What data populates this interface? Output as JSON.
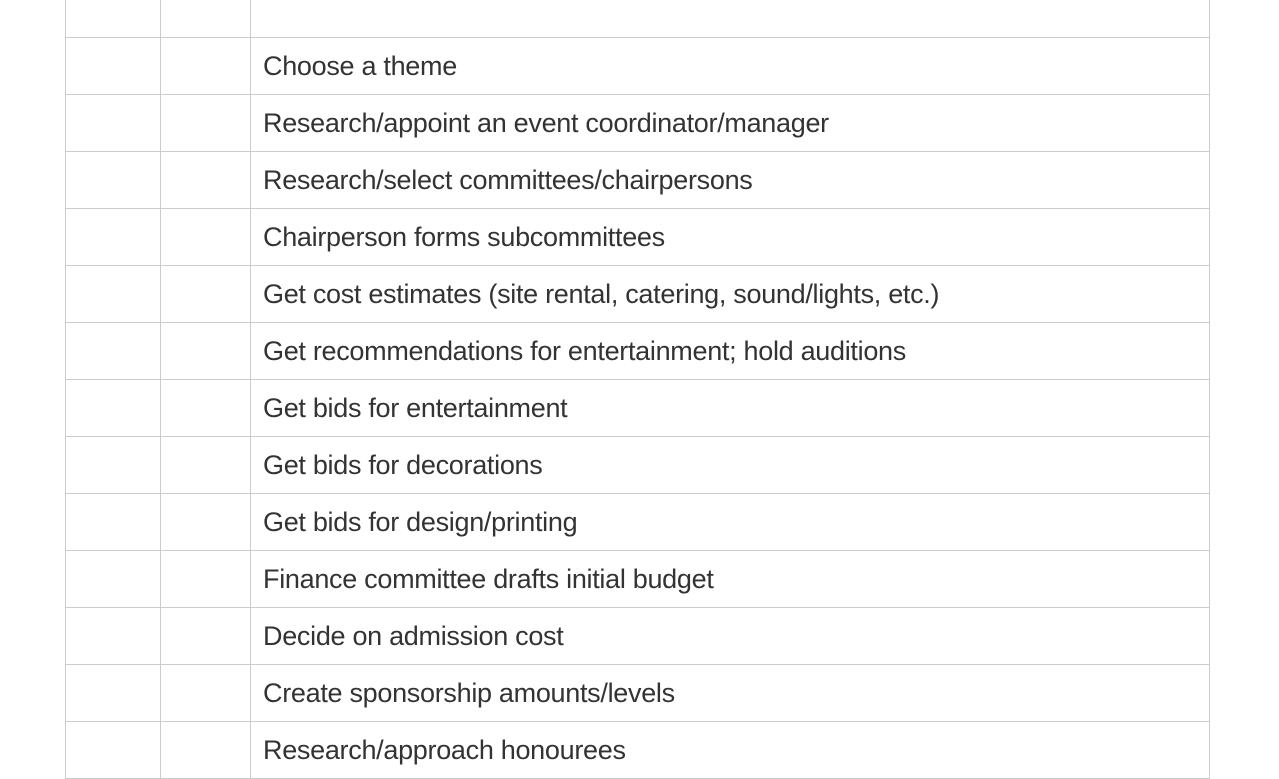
{
  "rows": [
    {
      "col1": "",
      "col2": "",
      "col3": ""
    },
    {
      "col1": "",
      "col2": "",
      "col3": "Choose a theme"
    },
    {
      "col1": "",
      "col2": "",
      "col3": "Research/appoint an event coordinator/manager"
    },
    {
      "col1": "",
      "col2": "",
      "col3": "Research/select committees/chairpersons"
    },
    {
      "col1": "",
      "col2": "",
      "col3": "Chairperson forms subcommittees"
    },
    {
      "col1": "",
      "col2": "",
      "col3": "Get cost estimates (site rental, catering, sound/lights, etc.)"
    },
    {
      "col1": "",
      "col2": "",
      "col3": "Get recommendations for entertainment; hold auditions"
    },
    {
      "col1": "",
      "col2": "",
      "col3": "Get bids for entertainment"
    },
    {
      "col1": "",
      "col2": "",
      "col3": "Get bids for decorations"
    },
    {
      "col1": "",
      "col2": "",
      "col3": "Get bids for design/printing"
    },
    {
      "col1": "",
      "col2": "",
      "col3": "Finance committee drafts initial budget"
    },
    {
      "col1": "",
      "col2": "",
      "col3": "Decide on admission cost"
    },
    {
      "col1": "",
      "col2": "",
      "col3": "Create sponsorship amounts/levels"
    },
    {
      "col1": "",
      "col2": "",
      "col3": "Research/approach honourees"
    }
  ]
}
